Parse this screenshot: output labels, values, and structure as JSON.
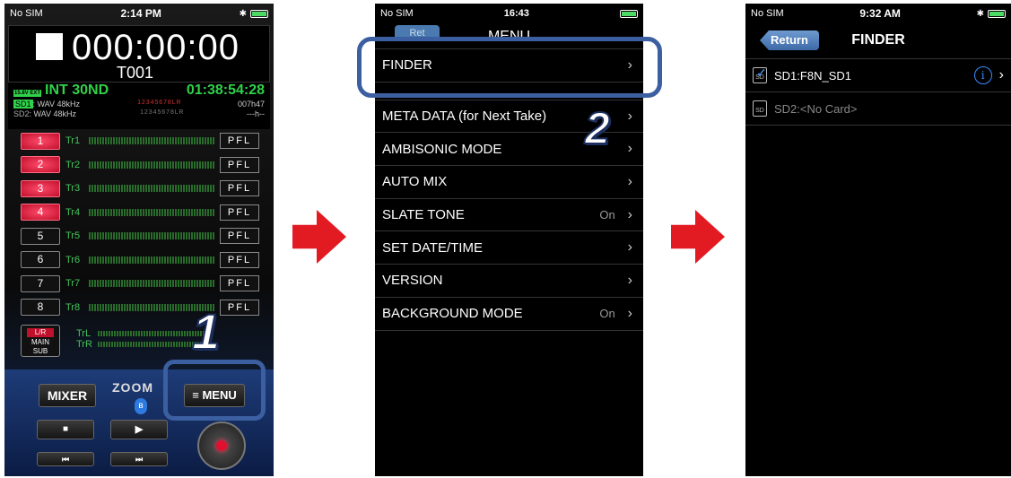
{
  "panel1": {
    "status": {
      "carrier": "No SIM",
      "time": "2:14 PM"
    },
    "counter": "000:00:00",
    "take": "T001",
    "power": "INT 30ND",
    "battery_label": "15.8V EXT",
    "remaining": "01:38:54:28",
    "sd1_label": "SD1",
    "sd1_format": ": WAV 48kHz",
    "sd2_label": "SD2",
    "sd2_format": ": WAV 48kHz",
    "sd1_tracks": "1 2 3 4 5 6 7 8 L R",
    "sd2_tracks": "1 2 3 4 5 6 7 8 L R",
    "sd1_remaining": "007h47",
    "sd2_remaining": "---h--",
    "tracks": [
      {
        "btn": "1",
        "label": "Tr1",
        "pfl": "PFL"
      },
      {
        "btn": "2",
        "label": "Tr2",
        "pfl": "PFL"
      },
      {
        "btn": "3",
        "label": "Tr3",
        "pfl": "PFL"
      },
      {
        "btn": "4",
        "label": "Tr4",
        "pfl": "PFL"
      },
      {
        "btn": "5",
        "label": "Tr5",
        "pfl": "PFL"
      },
      {
        "btn": "6",
        "label": "Tr6",
        "pfl": "PFL"
      },
      {
        "btn": "7",
        "label": "Tr7",
        "pfl": "PFL"
      },
      {
        "btn": "8",
        "label": "Tr8",
        "pfl": "PFL"
      }
    ],
    "main_lr": "L/R",
    "main_line1": "MAIN",
    "main_line2": "SUB",
    "lr_labels": [
      "TrL",
      "TrR"
    ],
    "mixer": "MIXER",
    "brand": "ZOOM",
    "menu": "≡ MENU",
    "step": "1"
  },
  "panel2": {
    "status": {
      "carrier": "No SIM",
      "time": "16:43"
    },
    "back": "Ret",
    "title": "MENU",
    "items": [
      {
        "label": "FINDER",
        "value": ""
      },
      {
        "label": "",
        "value": ""
      },
      {
        "label": "META DATA (for Next Take)",
        "value": ""
      },
      {
        "label": "AMBISONIC MODE",
        "value": ""
      },
      {
        "label": "AUTO MIX",
        "value": ""
      },
      {
        "label": "SLATE TONE",
        "value": "On"
      },
      {
        "label": "SET DATE/TIME",
        "value": ""
      },
      {
        "label": "VERSION",
        "value": ""
      },
      {
        "label": "BACKGROUND MODE",
        "value": "On"
      }
    ],
    "step": "2"
  },
  "panel3": {
    "status": {
      "carrier": "No SIM",
      "time": "9:32 AM"
    },
    "back": "Return",
    "title": "FINDER",
    "rows": [
      {
        "label": "SD1:F8N_SD1"
      },
      {
        "label": "SD2:<No Card>"
      }
    ]
  },
  "colors": {
    "accent_blue": "#3b5fa0",
    "arrow_red": "#e21b23",
    "level_green": "#2fd24a"
  }
}
